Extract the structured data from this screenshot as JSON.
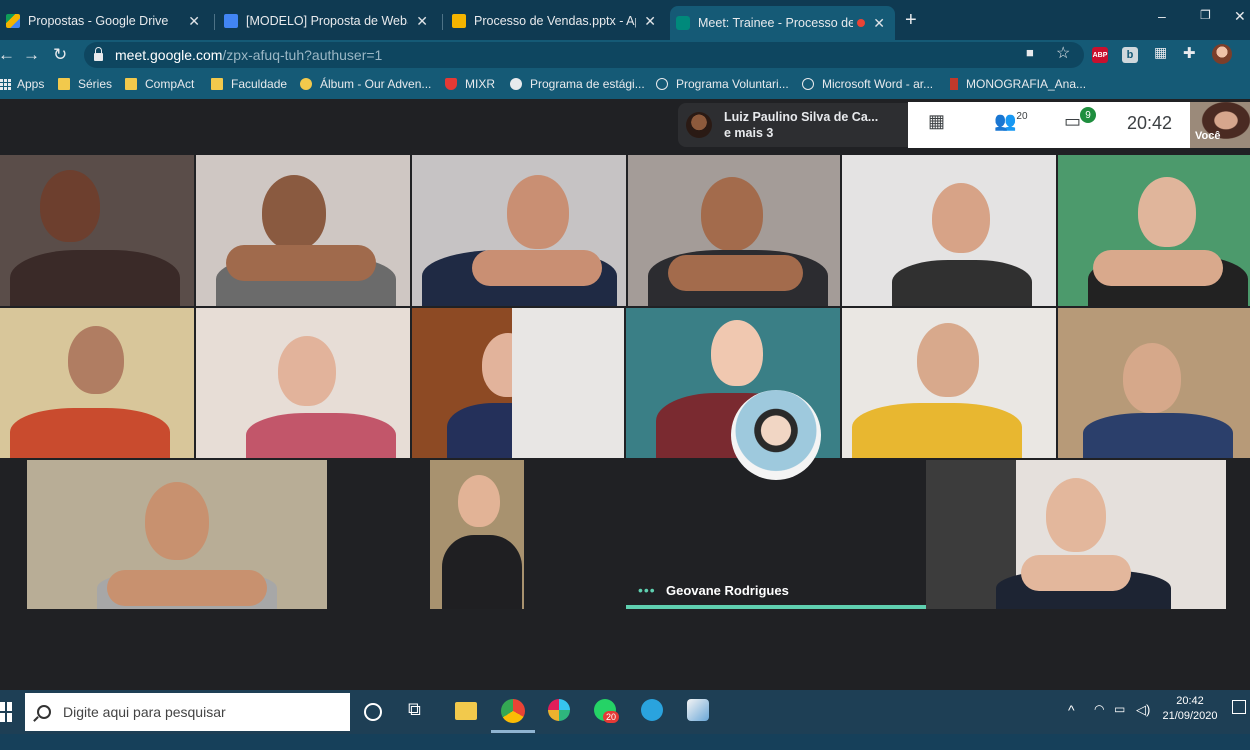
{
  "browser": {
    "tabs": [
      {
        "title": "Propostas - Google Drive",
        "close": "✕",
        "favicon_color": "#34a853"
      },
      {
        "title": "[MODELO] Proposta de WebSite",
        "close": "✕",
        "favicon_color": "#4285f4"
      },
      {
        "title": "Processo de Vendas.pptx - Apres",
        "close": "✕",
        "favicon_color": "#f4b400"
      },
      {
        "title": "Meet: Trainee - Processo de",
        "close": "✕",
        "favicon_color": "#00897b",
        "active": true
      }
    ],
    "new_tab": "+",
    "window_controls": {
      "minimize": "–",
      "restore": "❐",
      "close": "✕"
    },
    "url_host": "meet.google.com",
    "url_path": "/zpx-afuq-tuh?authuser=1",
    "extension_abp": "ABP",
    "extension_b": "b"
  },
  "bookmarks": [
    {
      "label": "Apps",
      "icon": "apps-icon"
    },
    {
      "label": "Séries",
      "icon": "folder-icon"
    },
    {
      "label": "CompAct",
      "icon": "folder-icon"
    },
    {
      "label": "Faculdade",
      "icon": "folder-icon"
    },
    {
      "label": "Álbum - Our Adven...",
      "icon": "emoji-icon"
    },
    {
      "label": "MIXR",
      "icon": "mixr-icon"
    },
    {
      "label": "Programa de estági...",
      "icon": "circle-icon"
    },
    {
      "label": "Programa Voluntari...",
      "icon": "globe-icon"
    },
    {
      "label": "Microsoft Word - ar...",
      "icon": "globe-icon"
    },
    {
      "label": "MONOGRAFIA_Ana...",
      "icon": "doc-icon"
    }
  ],
  "meet": {
    "presenter_name": "Luiz Paulino Silva de Ca...",
    "presenter_more": "e mais 3",
    "participants_count": "20",
    "chat_badge": "9",
    "time": "20:42",
    "self_label": "Você",
    "active_speaker": "Geovane Rodrigues"
  },
  "taskbar": {
    "search_placeholder": "Digite aqui para pesquisar",
    "whatsapp_badge": "20",
    "clock_time": "20:42",
    "clock_date": "21/09/2020"
  }
}
